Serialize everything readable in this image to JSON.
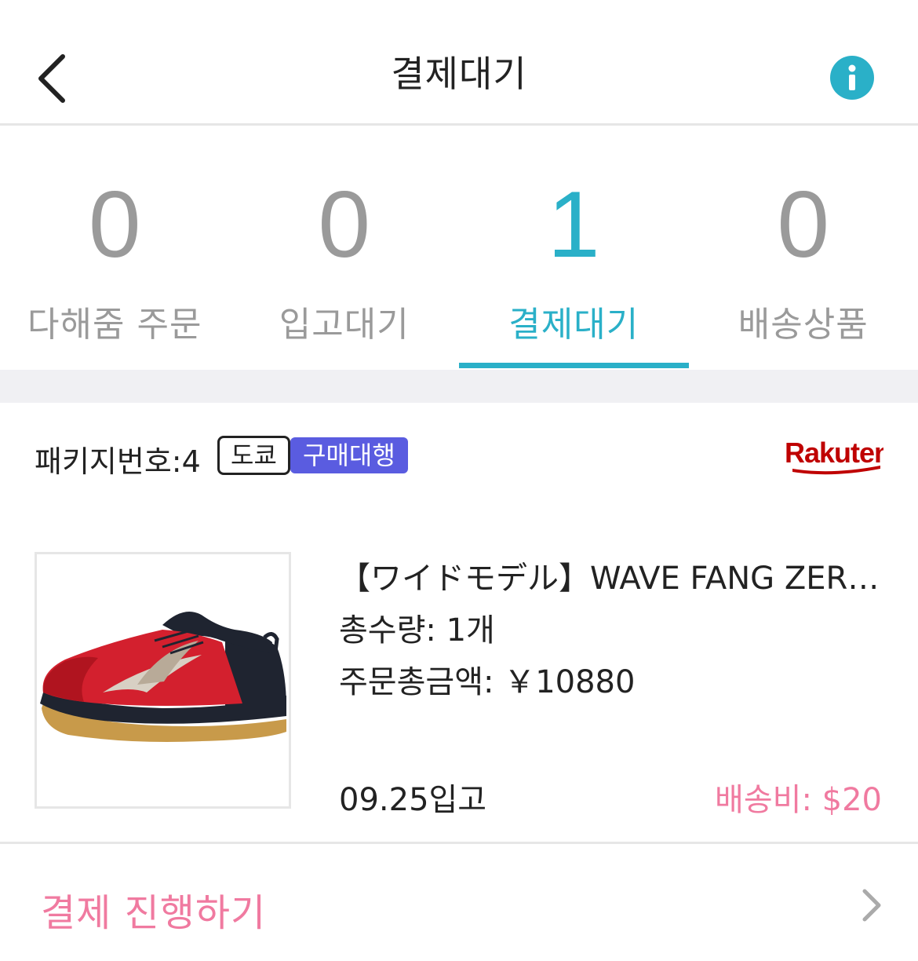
{
  "header": {
    "title": "결제대기",
    "back_icon": "chevron-left-icon",
    "info_icon": "info-icon",
    "info_color": "#2ab0c8"
  },
  "tabs": [
    {
      "count": "0",
      "label": "다해줌 주문",
      "active": false
    },
    {
      "count": "0",
      "label": "입고대기",
      "active": false
    },
    {
      "count": "1",
      "label": "결제대기",
      "active": true
    },
    {
      "count": "0",
      "label": "배송상품",
      "active": false
    }
  ],
  "accent_color": "#2ab0c8",
  "package": {
    "label": "패키지번호:4",
    "city_tag": "도쿄",
    "service_tag": "구매대행",
    "service_tag_color": "#5a5ce0",
    "store_logo_text": "Rakuten",
    "store_logo_color": "#bf0000"
  },
  "product": {
    "title": "【ワイドモデル】WAVE FANG ZER…",
    "quantity": "총수량: 1개",
    "total": "주문총금액: ￥10880",
    "arrival": "09.25입고",
    "shipping": "배송비: $20",
    "image_icon": "shoe-image"
  },
  "pay": {
    "label": "결제 진행하기",
    "chevron_icon": "chevron-right-icon",
    "color": "#f07aa0"
  }
}
